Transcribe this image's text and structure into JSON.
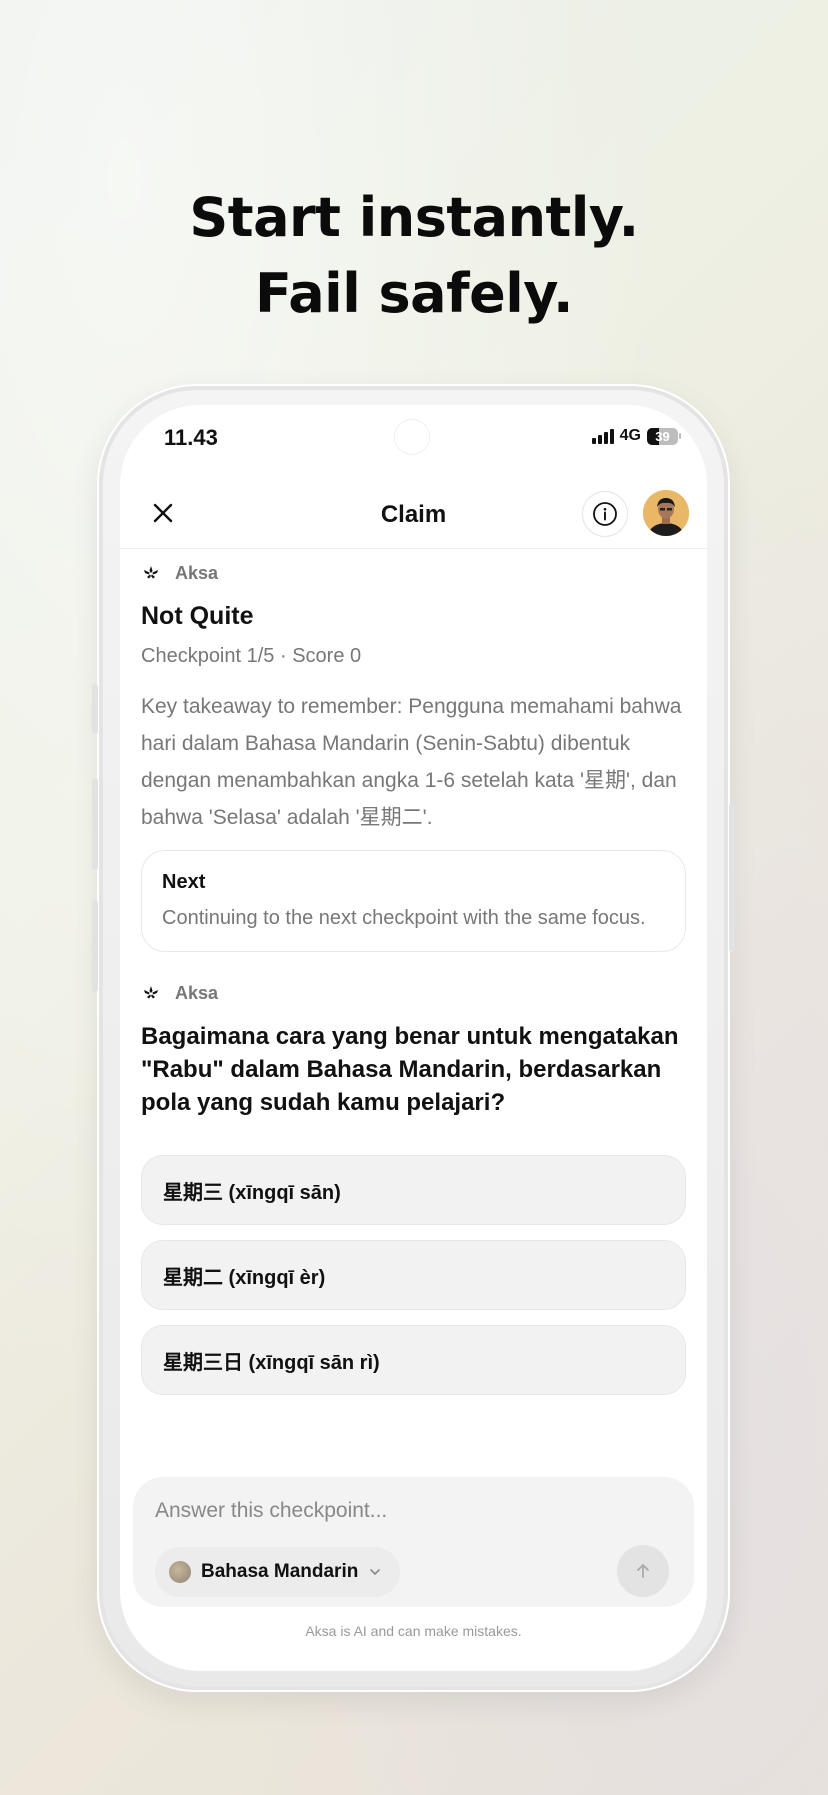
{
  "headline": {
    "line1": "Start instantly.",
    "line2": "Fail safely."
  },
  "status_bar": {
    "time": "11.43",
    "network": "4G",
    "battery_level": "39"
  },
  "nav": {
    "title": "Claim",
    "close_icon": "close-icon",
    "info_icon": "info-icon"
  },
  "feedback": {
    "agent_name": "Aksa",
    "title": "Not Quite",
    "subtitle": "Checkpoint 1/5 · Score 0",
    "takeaway": "Key takeaway to remember: Pengguna memahami bahwa hari dalam Bahasa Mandarin (Senin-Sabtu) dibentuk dengan menambahkan angka 1-6 setelah kata '星期', dan bahwa 'Selasa' adalah '星期二'.",
    "next_label": "Next",
    "next_text": "Continuing to the next checkpoint with the same focus."
  },
  "question": {
    "agent_name": "Aksa",
    "text": "Bagaimana cara yang benar untuk mengatakan \"Rabu\" dalam Bahasa Mandarin, berdasarkan pola yang sudah kamu pelajari?",
    "options": [
      "星期三 (xīngqī sān)",
      "星期二 (xīngqī èr)",
      "星期三日 (xīngqī sān rì)"
    ]
  },
  "composer": {
    "placeholder": "Answer this checkpoint...",
    "language": "Bahasa Mandarin"
  },
  "disclaimer": "Aksa is AI and can make mistakes.",
  "colors": {
    "text_primary": "#111111",
    "text_secondary": "#777777",
    "option_bg": "#f2f2f2"
  }
}
